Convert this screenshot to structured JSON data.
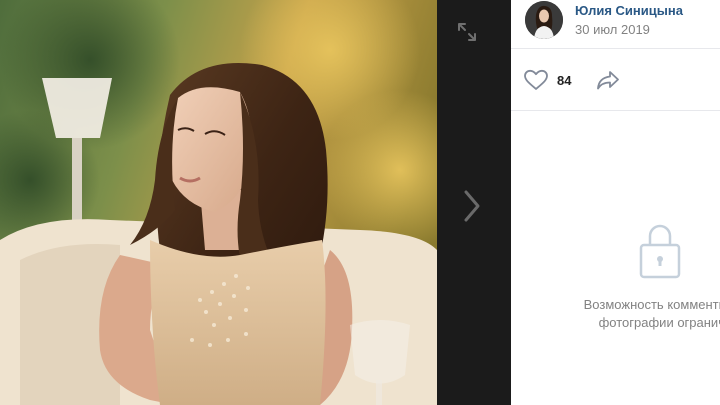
{
  "viewer": {
    "icons": {
      "expand": "expand-icon",
      "next": "chevron-right-icon"
    }
  },
  "post": {
    "author_name": "Юлия Синицына",
    "date": "30 июл 2019",
    "likes_count": "84",
    "icons": {
      "like": "heart-icon",
      "share": "share-arrow-icon",
      "lock": "lock-icon"
    }
  },
  "comments": {
    "disabled_line1": "Возможность комментирова",
    "disabled_line2": "фотографии ограничен"
  },
  "colors": {
    "link": "#2a5885",
    "muted": "#828282",
    "divider": "#e7e8ec",
    "viewer_bg": "#1b1b1b"
  }
}
